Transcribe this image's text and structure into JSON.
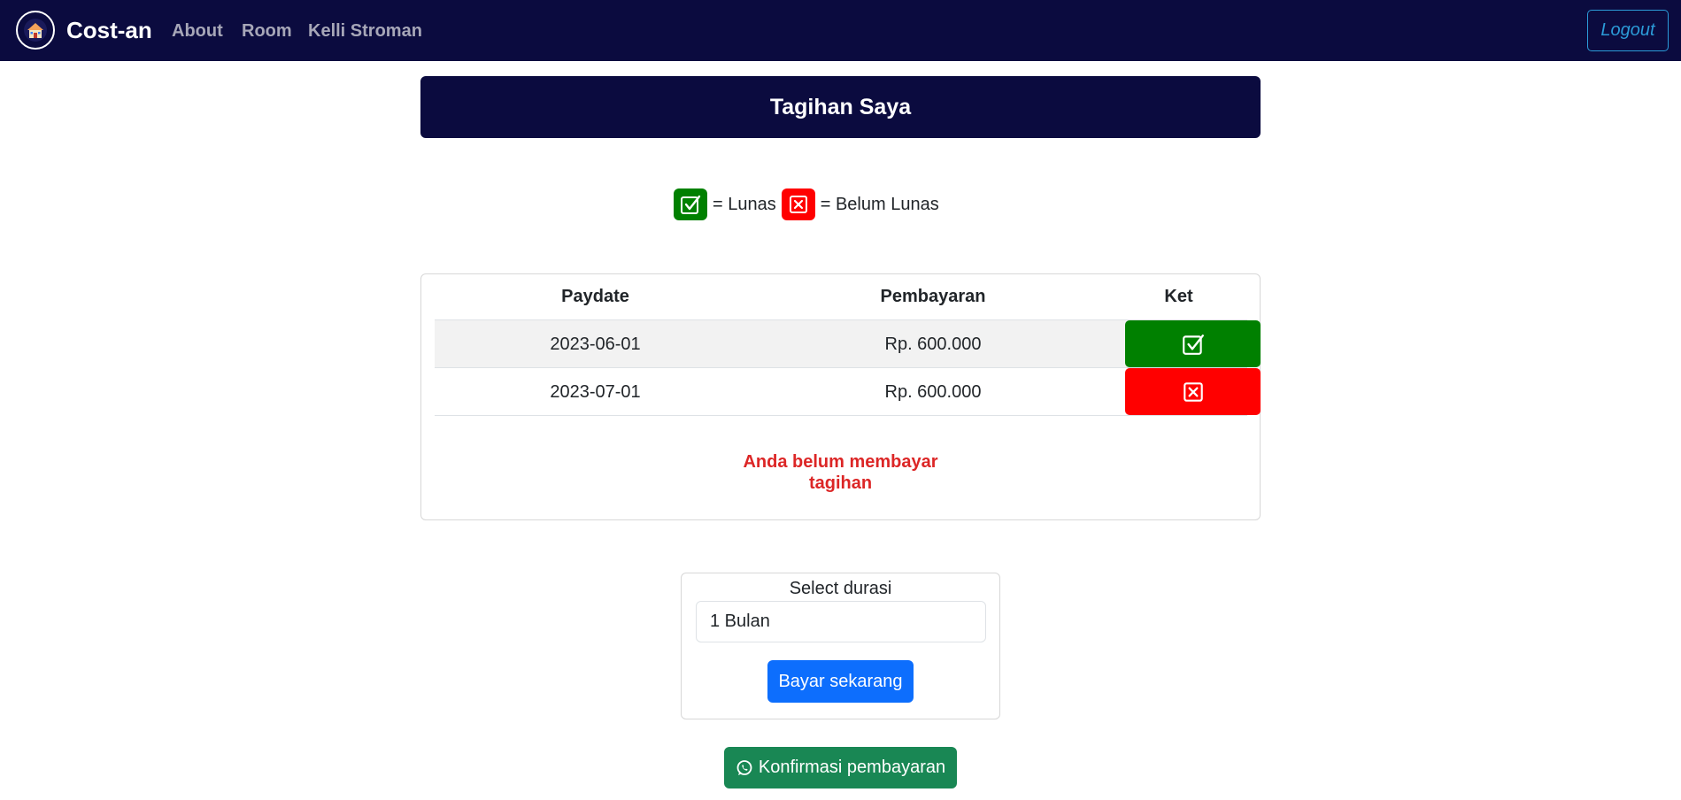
{
  "navbar": {
    "brand": "Cost-an",
    "links": [
      "About",
      "Room",
      "Kelli Stroman"
    ],
    "logout_label": "Logout"
  },
  "header": {
    "title": "Tagihan Saya"
  },
  "legend": {
    "paid_label": "= Lunas",
    "unpaid_label": "= Belum Lunas",
    "paid_icon": "check-square-icon",
    "unpaid_icon": "x-square-icon",
    "paid_color": "#008000",
    "unpaid_color": "#ff0000"
  },
  "table": {
    "headers": [
      "Paydate",
      "Pembayaran",
      "Ket"
    ],
    "rows": [
      {
        "paydate": "2023-06-01",
        "amount": "Rp. 600.000",
        "status": "paid"
      },
      {
        "paydate": "2023-07-01",
        "amount": "Rp. 600.000",
        "status": "unpaid"
      }
    ],
    "notice": "Anda belum membayar tagihan"
  },
  "duration": {
    "label": "Select durasi",
    "selected": "1 Bulan",
    "pay_label": "Bayar sekarang"
  },
  "confirm": {
    "label": "Konfirmasi pembayaran",
    "icon": "whatsapp-icon"
  },
  "colors": {
    "navbar": "#0b0b3f",
    "primary": "#0d6efd",
    "success": "#198754",
    "notice": "#dc2626"
  }
}
